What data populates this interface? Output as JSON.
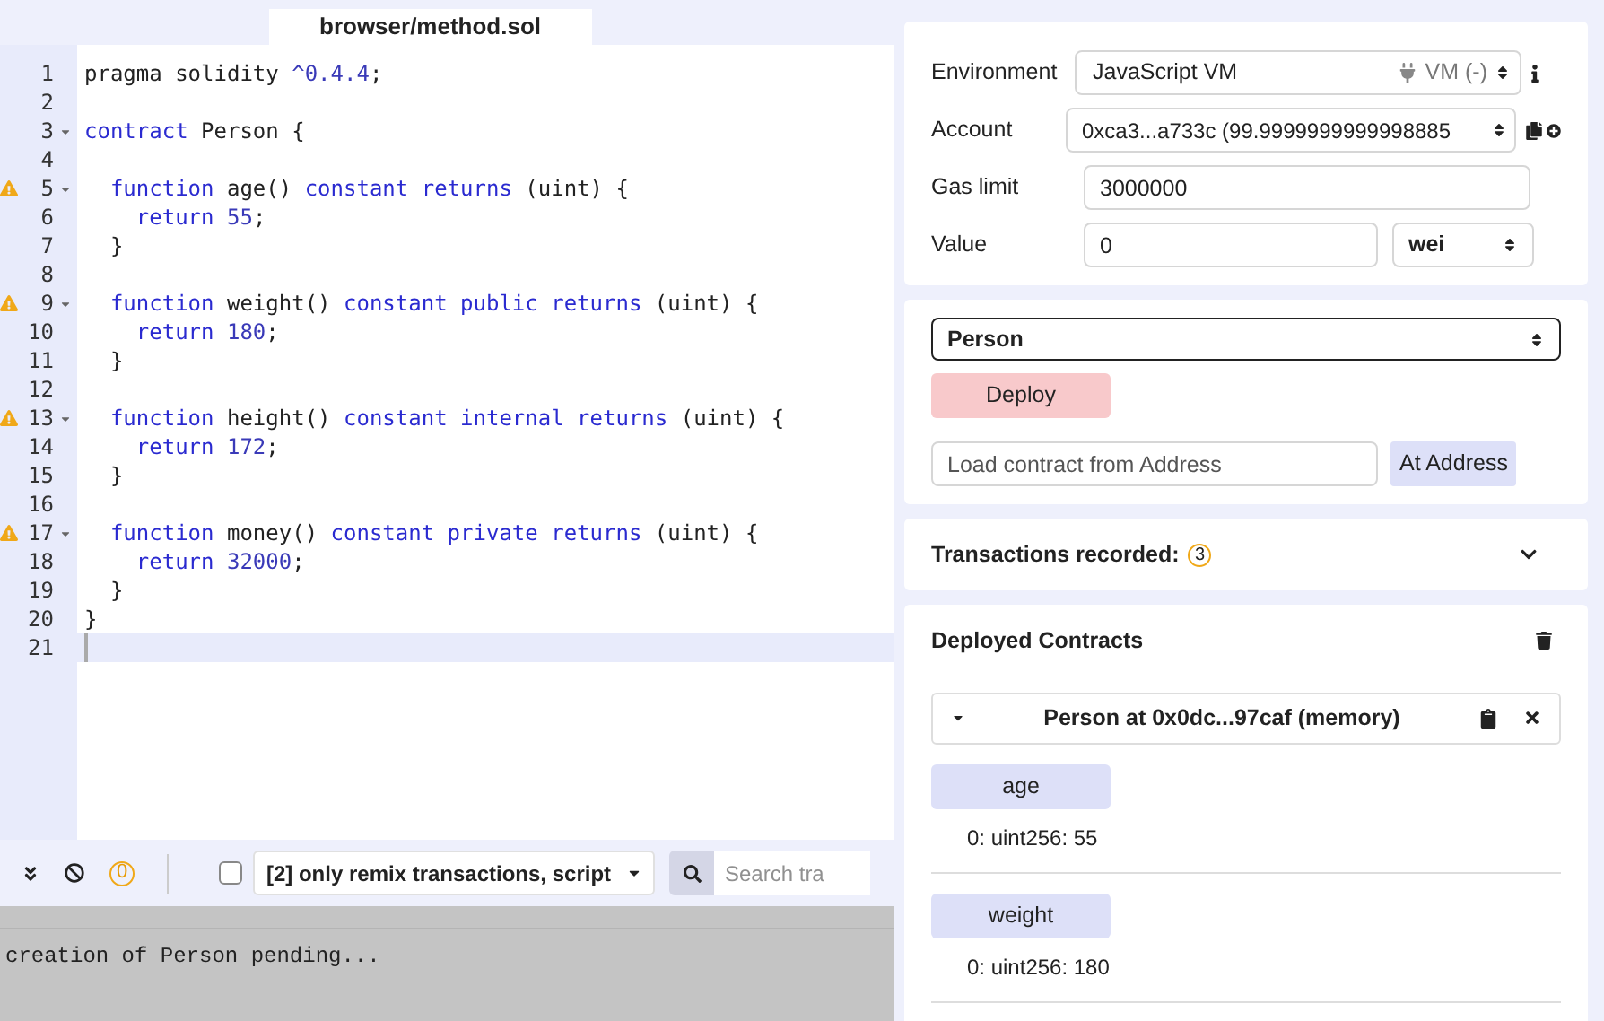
{
  "file_tab": {
    "label": "browser/method.sol",
    "selected": true
  },
  "editor": {
    "lines": [
      {
        "number": "1",
        "tokens": [
          {
            "kind": "plain",
            "text": "pragma solidity "
          },
          {
            "kind": "num",
            "text": "^0.4.4"
          },
          {
            "kind": "plain",
            "text": ";"
          }
        ]
      },
      {
        "number": "2"
      },
      {
        "number": "3",
        "foldable": true,
        "tokens": [
          {
            "kind": "kw",
            "text": "contract"
          },
          {
            "kind": "plain",
            "text": " Person {"
          }
        ]
      },
      {
        "number": "4"
      },
      {
        "number": "5",
        "warning": true,
        "foldable": true,
        "tokens": [
          {
            "kind": "kw",
            "text": "  function"
          },
          {
            "kind": "plain",
            "text": " age() "
          },
          {
            "kind": "kw",
            "text": "constant returns"
          },
          {
            "kind": "plain",
            "text": " (uint) {"
          }
        ]
      },
      {
        "number": "6",
        "tokens": [
          {
            "kind": "kw",
            "text": "    return "
          },
          {
            "kind": "num",
            "text": "55"
          },
          {
            "kind": "plain",
            "text": ";"
          }
        ]
      },
      {
        "number": "7",
        "tokens": [
          {
            "kind": "plain",
            "text": "  }"
          }
        ]
      },
      {
        "number": "8"
      },
      {
        "number": "9",
        "warning": true,
        "foldable": true,
        "tokens": [
          {
            "kind": "kw",
            "text": "  function"
          },
          {
            "kind": "plain",
            "text": " weight() "
          },
          {
            "kind": "kw",
            "text": "constant public returns"
          },
          {
            "kind": "plain",
            "text": " (uint) {"
          }
        ]
      },
      {
        "number": "10",
        "tokens": [
          {
            "kind": "kw",
            "text": "    return "
          },
          {
            "kind": "num",
            "text": "180"
          },
          {
            "kind": "plain",
            "text": ";"
          }
        ]
      },
      {
        "number": "11",
        "tokens": [
          {
            "kind": "plain",
            "text": "  }"
          }
        ]
      },
      {
        "number": "12"
      },
      {
        "number": "13",
        "warning": true,
        "foldable": true,
        "tokens": [
          {
            "kind": "kw",
            "text": "  function"
          },
          {
            "kind": "plain",
            "text": " height() "
          },
          {
            "kind": "kw",
            "text": "constant internal returns"
          },
          {
            "kind": "plain",
            "text": " (uint) {"
          }
        ]
      },
      {
        "number": "14",
        "tokens": [
          {
            "kind": "kw",
            "text": "    return "
          },
          {
            "kind": "num",
            "text": "172"
          },
          {
            "kind": "plain",
            "text": ";"
          }
        ]
      },
      {
        "number": "15",
        "tokens": [
          {
            "kind": "plain",
            "text": "  }"
          }
        ]
      },
      {
        "number": "16"
      },
      {
        "number": "17",
        "warning": true,
        "foldable": true,
        "tokens": [
          {
            "kind": "kw",
            "text": "  function"
          },
          {
            "kind": "plain",
            "text": " money() "
          },
          {
            "kind": "kw",
            "text": "constant private returns"
          },
          {
            "kind": "plain",
            "text": " (uint) {"
          }
        ]
      },
      {
        "number": "18",
        "tokens": [
          {
            "kind": "kw",
            "text": "    return "
          },
          {
            "kind": "num",
            "text": "32000"
          },
          {
            "kind": "plain",
            "text": ";"
          }
        ]
      },
      {
        "number": "19",
        "tokens": [
          {
            "kind": "plain",
            "text": "  }"
          }
        ]
      },
      {
        "number": "20",
        "tokens": [
          {
            "kind": "plain",
            "text": "}"
          }
        ]
      },
      {
        "number": "21",
        "active": true
      }
    ]
  },
  "terminal": {
    "pending_count": "0",
    "checkbox_checked": false,
    "filter": "[2] only remix transactions, script",
    "search_placeholder": "Search tra",
    "output": "creation of Person pending..."
  },
  "run_panel": {
    "environment": {
      "label": "Environment",
      "value": "JavaScript VM",
      "badge": "VM (-)"
    },
    "account": {
      "label": "Account",
      "value": "0xca3...a733c (99.9999999999998885"
    },
    "gas_limit": {
      "label": "Gas limit",
      "value": "3000000"
    },
    "value": {
      "label": "Value",
      "value": "0",
      "unit": "wei"
    }
  },
  "deploy_panel": {
    "contract": "Person",
    "deploy_button": "Deploy",
    "address_placeholder": "Load contract from Address",
    "at_address_button": "At Address"
  },
  "transactions": {
    "label": "Transactions recorded:",
    "count": "3"
  },
  "deployed": {
    "title": "Deployed Contracts",
    "instance": {
      "title": "Person at 0x0dc...97caf (memory)",
      "expanded": true,
      "functions": [
        {
          "name": "age",
          "result": "0: uint256: 55"
        },
        {
          "name": "weight",
          "result": "0: uint256: 180"
        }
      ]
    }
  }
}
